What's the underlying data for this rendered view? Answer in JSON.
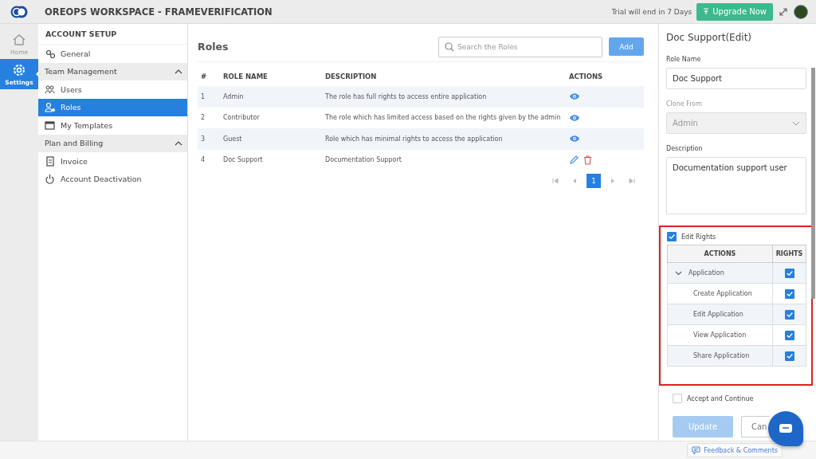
{
  "header": {
    "title": "OREOPS WORKSPACE - FRAMEVERIFICATION",
    "trial": "Trial will end in 7 Days",
    "upgrade": "Upgrade Now"
  },
  "rail": [
    {
      "label": "Home",
      "selected": false
    },
    {
      "label": "Settings",
      "selected": true
    }
  ],
  "sidebar": {
    "title": "ACCOUNT SETUP",
    "items": [
      {
        "kind": "item",
        "label": "General",
        "selected": false
      },
      {
        "kind": "group",
        "label": "Team Management",
        "expanded": true
      },
      {
        "kind": "item",
        "label": "Users",
        "selected": false
      },
      {
        "kind": "item",
        "label": "Roles",
        "selected": true
      },
      {
        "kind": "item",
        "label": "My Templates",
        "selected": false
      },
      {
        "kind": "group",
        "label": "Plan and Billing",
        "expanded": true
      },
      {
        "kind": "item",
        "label": "Invoice",
        "selected": false
      },
      {
        "kind": "item",
        "label": "Account Deactivation",
        "selected": false
      }
    ]
  },
  "roles": {
    "title": "Roles",
    "search": {
      "placeholder": "Search the Roles"
    },
    "add": "Add",
    "columns": [
      "#",
      "ROLE NAME",
      "DESCRIPTION",
      "ACTIONS"
    ],
    "rows": [
      {
        "kind": "view",
        "num": "1",
        "name": "Admin",
        "description": "The role has full rights to access entire application"
      },
      {
        "kind": "view",
        "num": "2",
        "name": "Contributor",
        "description": "The role which has limited access based on the rights given by the admin"
      },
      {
        "kind": "view",
        "num": "3",
        "name": "Guest",
        "description": "Role which has minimal rights to access the application"
      },
      {
        "kind": "edit",
        "num": "4",
        "name": "Doc Support",
        "description": "Documentation Support"
      }
    ],
    "pages": [
      {
        "label": "1",
        "selected": true
      }
    ]
  },
  "editor": {
    "title": "Doc Support(Edit)",
    "role_name": {
      "label": "Role Name",
      "value": "Doc Support"
    },
    "clone_from": {
      "label": "Clone From",
      "value": "Admin",
      "disabled": true
    },
    "description": {
      "label": "Description",
      "value": "Documentation support user"
    },
    "edit_rights": {
      "label": "Edit Rights",
      "checked": true
    },
    "rights_columns": [
      "ACTIONS",
      "RIGHTS"
    ],
    "rights": [
      {
        "label": "Application",
        "expanded": true,
        "checked": true,
        "children": [
          {
            "label": "Create Application",
            "checked": true
          },
          {
            "label": "Edit Application",
            "checked": true
          },
          {
            "label": "View Application",
            "checked": true
          },
          {
            "label": "Share Application",
            "checked": true
          }
        ]
      }
    ],
    "accept": {
      "label": "Accept and Continue",
      "checked": false
    },
    "update": {
      "label": "Update",
      "disabled": true
    },
    "cancel": "Can"
  },
  "footer": {
    "feedback": "Feedback & Comments"
  }
}
